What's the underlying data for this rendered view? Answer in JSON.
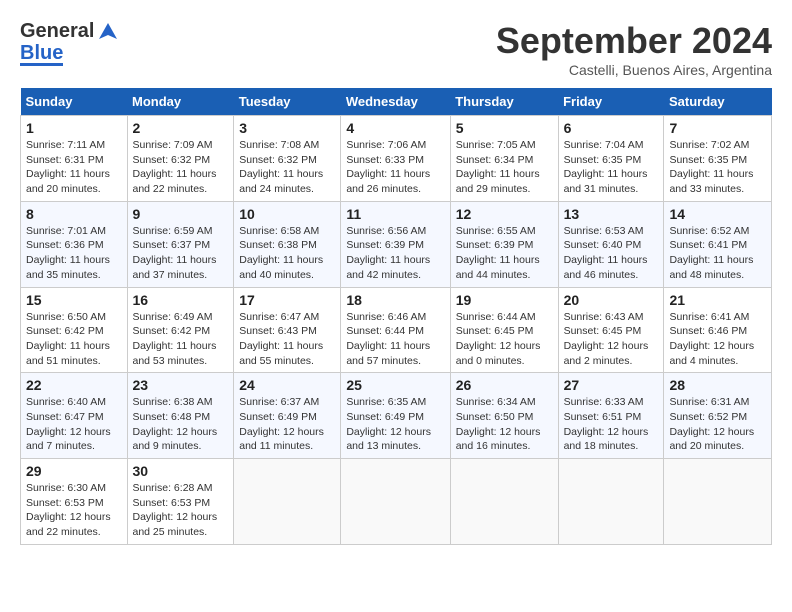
{
  "header": {
    "logo_general": "General",
    "logo_blue": "Blue",
    "title": "September 2024",
    "subtitle": "Castelli, Buenos Aires, Argentina"
  },
  "columns": [
    "Sunday",
    "Monday",
    "Tuesday",
    "Wednesday",
    "Thursday",
    "Friday",
    "Saturday"
  ],
  "weeks": [
    [
      {
        "day": "1",
        "info": "Sunrise: 7:11 AM\nSunset: 6:31 PM\nDaylight: 11 hours\nand 20 minutes."
      },
      {
        "day": "2",
        "info": "Sunrise: 7:09 AM\nSunset: 6:32 PM\nDaylight: 11 hours\nand 22 minutes."
      },
      {
        "day": "3",
        "info": "Sunrise: 7:08 AM\nSunset: 6:32 PM\nDaylight: 11 hours\nand 24 minutes."
      },
      {
        "day": "4",
        "info": "Sunrise: 7:06 AM\nSunset: 6:33 PM\nDaylight: 11 hours\nand 26 minutes."
      },
      {
        "day": "5",
        "info": "Sunrise: 7:05 AM\nSunset: 6:34 PM\nDaylight: 11 hours\nand 29 minutes."
      },
      {
        "day": "6",
        "info": "Sunrise: 7:04 AM\nSunset: 6:35 PM\nDaylight: 11 hours\nand 31 minutes."
      },
      {
        "day": "7",
        "info": "Sunrise: 7:02 AM\nSunset: 6:35 PM\nDaylight: 11 hours\nand 33 minutes."
      }
    ],
    [
      {
        "day": "8",
        "info": "Sunrise: 7:01 AM\nSunset: 6:36 PM\nDaylight: 11 hours\nand 35 minutes."
      },
      {
        "day": "9",
        "info": "Sunrise: 6:59 AM\nSunset: 6:37 PM\nDaylight: 11 hours\nand 37 minutes."
      },
      {
        "day": "10",
        "info": "Sunrise: 6:58 AM\nSunset: 6:38 PM\nDaylight: 11 hours\nand 40 minutes."
      },
      {
        "day": "11",
        "info": "Sunrise: 6:56 AM\nSunset: 6:39 PM\nDaylight: 11 hours\nand 42 minutes."
      },
      {
        "day": "12",
        "info": "Sunrise: 6:55 AM\nSunset: 6:39 PM\nDaylight: 11 hours\nand 44 minutes."
      },
      {
        "day": "13",
        "info": "Sunrise: 6:53 AM\nSunset: 6:40 PM\nDaylight: 11 hours\nand 46 minutes."
      },
      {
        "day": "14",
        "info": "Sunrise: 6:52 AM\nSunset: 6:41 PM\nDaylight: 11 hours\nand 48 minutes."
      }
    ],
    [
      {
        "day": "15",
        "info": "Sunrise: 6:50 AM\nSunset: 6:42 PM\nDaylight: 11 hours\nand 51 minutes."
      },
      {
        "day": "16",
        "info": "Sunrise: 6:49 AM\nSunset: 6:42 PM\nDaylight: 11 hours\nand 53 minutes."
      },
      {
        "day": "17",
        "info": "Sunrise: 6:47 AM\nSunset: 6:43 PM\nDaylight: 11 hours\nand 55 minutes."
      },
      {
        "day": "18",
        "info": "Sunrise: 6:46 AM\nSunset: 6:44 PM\nDaylight: 11 hours\nand 57 minutes."
      },
      {
        "day": "19",
        "info": "Sunrise: 6:44 AM\nSunset: 6:45 PM\nDaylight: 12 hours\nand 0 minutes."
      },
      {
        "day": "20",
        "info": "Sunrise: 6:43 AM\nSunset: 6:45 PM\nDaylight: 12 hours\nand 2 minutes."
      },
      {
        "day": "21",
        "info": "Sunrise: 6:41 AM\nSunset: 6:46 PM\nDaylight: 12 hours\nand 4 minutes."
      }
    ],
    [
      {
        "day": "22",
        "info": "Sunrise: 6:40 AM\nSunset: 6:47 PM\nDaylight: 12 hours\nand 7 minutes."
      },
      {
        "day": "23",
        "info": "Sunrise: 6:38 AM\nSunset: 6:48 PM\nDaylight: 12 hours\nand 9 minutes."
      },
      {
        "day": "24",
        "info": "Sunrise: 6:37 AM\nSunset: 6:49 PM\nDaylight: 12 hours\nand 11 minutes."
      },
      {
        "day": "25",
        "info": "Sunrise: 6:35 AM\nSunset: 6:49 PM\nDaylight: 12 hours\nand 13 minutes."
      },
      {
        "day": "26",
        "info": "Sunrise: 6:34 AM\nSunset: 6:50 PM\nDaylight: 12 hours\nand 16 minutes."
      },
      {
        "day": "27",
        "info": "Sunrise: 6:33 AM\nSunset: 6:51 PM\nDaylight: 12 hours\nand 18 minutes."
      },
      {
        "day": "28",
        "info": "Sunrise: 6:31 AM\nSunset: 6:52 PM\nDaylight: 12 hours\nand 20 minutes."
      }
    ],
    [
      {
        "day": "29",
        "info": "Sunrise: 6:30 AM\nSunset: 6:53 PM\nDaylight: 12 hours\nand 22 minutes."
      },
      {
        "day": "30",
        "info": "Sunrise: 6:28 AM\nSunset: 6:53 PM\nDaylight: 12 hours\nand 25 minutes."
      },
      {
        "day": "",
        "info": ""
      },
      {
        "day": "",
        "info": ""
      },
      {
        "day": "",
        "info": ""
      },
      {
        "day": "",
        "info": ""
      },
      {
        "day": "",
        "info": ""
      }
    ]
  ]
}
